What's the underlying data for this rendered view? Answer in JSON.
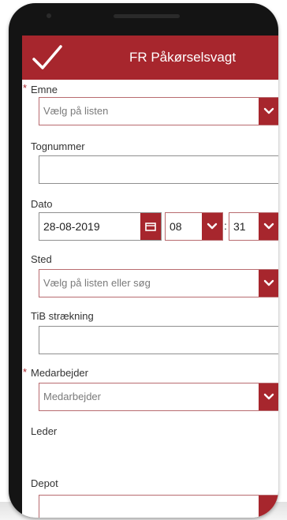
{
  "header": {
    "title": "FR Påkørselsvagt",
    "save_icon": "checkmark-icon"
  },
  "colors": {
    "accent": "#a7262d"
  },
  "fields": {
    "emne": {
      "label": "Emne",
      "required": "*",
      "placeholder": "Vælg på listen"
    },
    "tognummer": {
      "label": "Tognummer",
      "value": ""
    },
    "dato": {
      "label": "Dato",
      "date": "28-08-2019",
      "hour": "08",
      "separator": ":",
      "minute": "31"
    },
    "sted": {
      "label": "Sted",
      "placeholder": "Vælg på listen eller søg"
    },
    "tib": {
      "label": "TiB strækning",
      "value": ""
    },
    "medarbejder": {
      "label": "Medarbejder",
      "required": "*",
      "placeholder": "Medarbejder"
    },
    "leder": {
      "label": "Leder"
    },
    "depot": {
      "label": "Depot"
    }
  }
}
